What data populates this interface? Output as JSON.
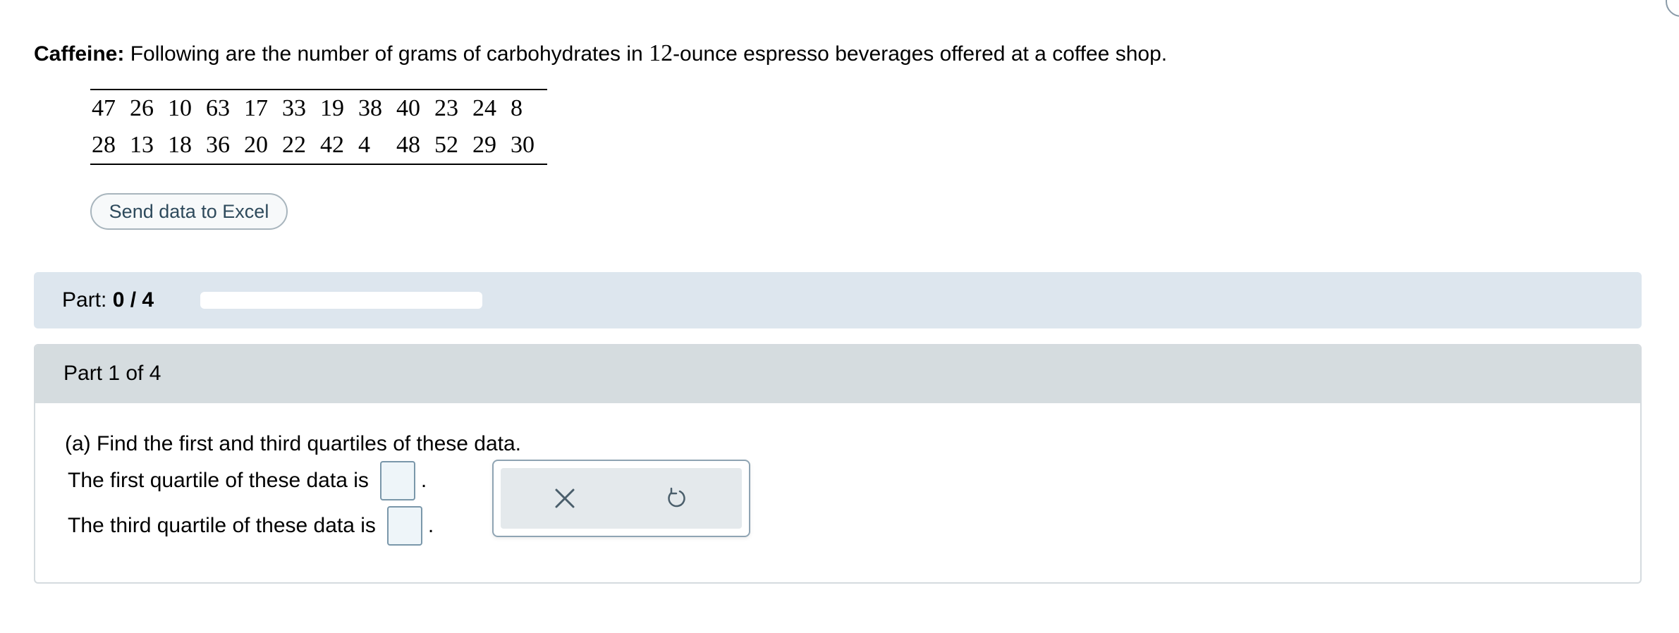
{
  "question": {
    "title": "Caffeine:",
    "text_before_number": " Following are the number of grams of carbohydrates in ",
    "number": "12",
    "text_after_number": "-ounce espresso beverages offered at a coffee shop."
  },
  "data_table": {
    "rows": [
      [
        "47",
        "26",
        "10",
        "63",
        "17",
        "33",
        "19",
        "38",
        "40",
        "23",
        "24",
        "8"
      ],
      [
        "28",
        "13",
        "18",
        "36",
        "20",
        "22",
        "42",
        "4",
        "48",
        "52",
        "29",
        "30"
      ]
    ]
  },
  "buttons": {
    "send_to_excel": "Send data to Excel"
  },
  "progress": {
    "label": "Part: ",
    "value_text": "0 / 4",
    "completed": 0,
    "total": 4
  },
  "part": {
    "title": "Part 1 of 4",
    "question": "(a) Find the first and third quartiles of these data.",
    "first_quartile_label": "The first quartile of these data is",
    "third_quartile_label": "The third quartile of these data is",
    "period": "."
  },
  "tools": {
    "clear_icon": "close-icon",
    "undo_icon": "undo-icon"
  },
  "colors": {
    "progress_background": "#dde6ee",
    "part_header_background": "#d5dcdf",
    "input_border": "#7a97aa",
    "button_text": "#2e4a5c"
  }
}
